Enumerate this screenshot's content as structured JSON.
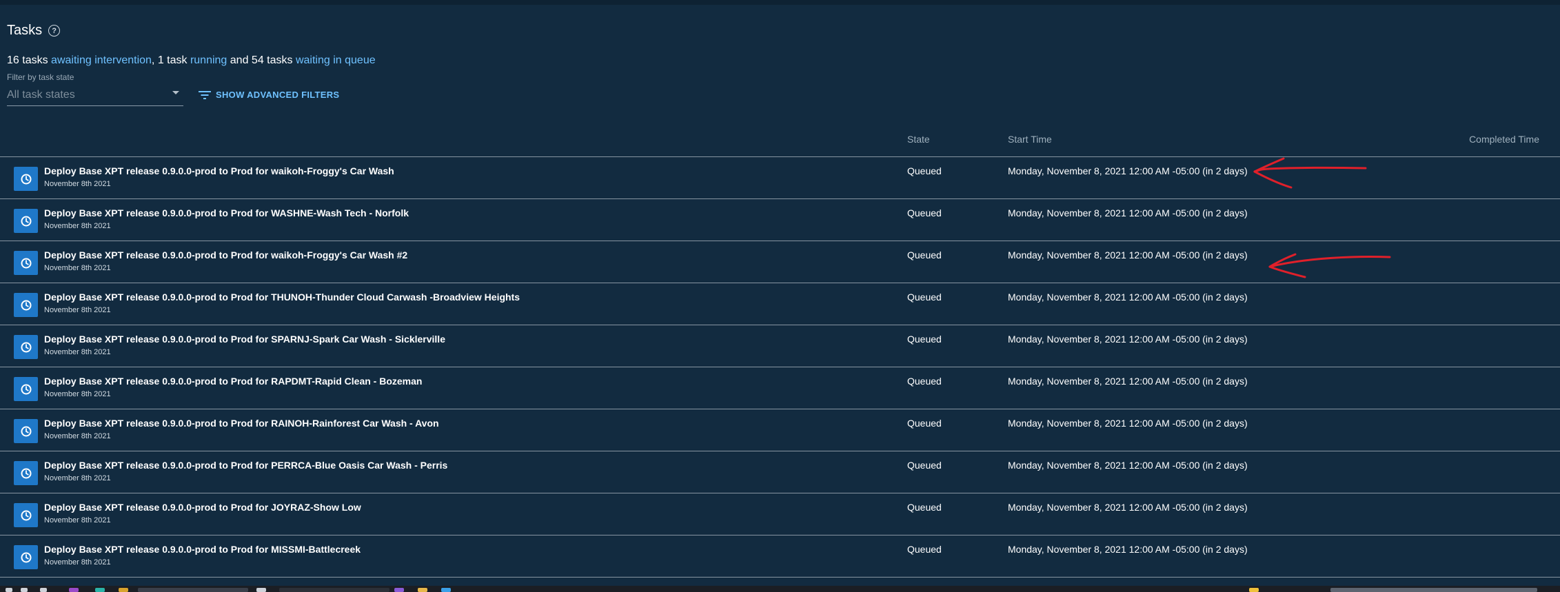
{
  "header": {
    "title": "Tasks"
  },
  "summary": {
    "intervention_count": "16 tasks",
    "intervention_link": "awaiting intervention",
    "sep1": ", 1 task",
    "running_link": "running",
    "sep2": "and 54 tasks",
    "queue_link": "waiting in queue"
  },
  "filter": {
    "label": "Filter by task state",
    "value": "All task states",
    "advanced_label": "SHOW ADVANCED FILTERS"
  },
  "columns": {
    "state": "State",
    "start_time": "Start Time",
    "completed_time": "Completed Time"
  },
  "rows": [
    {
      "title": "Deploy Base XPT release 0.9.0.0-prod to Prod for waikoh-Froggy's Car Wash",
      "date": "November 8th 2021",
      "state": "Queued",
      "start": "Monday, November 8, 2021 12:00 AM -05:00 (in 2 days)"
    },
    {
      "title": "Deploy Base XPT release 0.9.0.0-prod to Prod for WASHNE-Wash Tech - Norfolk",
      "date": "November 8th 2021",
      "state": "Queued",
      "start": "Monday, November 8, 2021 12:00 AM -05:00 (in 2 days)"
    },
    {
      "title": "Deploy Base XPT release 0.9.0.0-prod to Prod for waikoh-Froggy's Car Wash #2",
      "date": "November 8th 2021",
      "state": "Queued",
      "start": "Monday, November 8, 2021 12:00 AM -05:00 (in 2 days)"
    },
    {
      "title": "Deploy Base XPT release 0.9.0.0-prod to Prod for THUNOH-Thunder Cloud Carwash -Broadview Heights",
      "date": "November 8th 2021",
      "state": "Queued",
      "start": "Monday, November 8, 2021 12:00 AM -05:00 (in 2 days)"
    },
    {
      "title": "Deploy Base XPT release 0.9.0.0-prod to Prod for SPARNJ-Spark Car Wash - Sicklerville",
      "date": "November 8th 2021",
      "state": "Queued",
      "start": "Monday, November 8, 2021 12:00 AM -05:00 (in 2 days)"
    },
    {
      "title": "Deploy Base XPT release 0.9.0.0-prod to Prod for RAPDMT-Rapid Clean - Bozeman",
      "date": "November 8th 2021",
      "state": "Queued",
      "start": "Monday, November 8, 2021 12:00 AM -05:00 (in 2 days)"
    },
    {
      "title": "Deploy Base XPT release 0.9.0.0-prod to Prod for RAINOH-Rainforest Car Wash - Avon",
      "date": "November 8th 2021",
      "state": "Queued",
      "start": "Monday, November 8, 2021 12:00 AM -05:00 (in 2 days)"
    },
    {
      "title": "Deploy Base XPT release 0.9.0.0-prod to Prod for PERRCA-Blue Oasis Car Wash - Perris",
      "date": "November 8th 2021",
      "state": "Queued",
      "start": "Monday, November 8, 2021 12:00 AM -05:00 (in 2 days)"
    },
    {
      "title": "Deploy Base XPT release 0.9.0.0-prod to Prod for JOYRAZ-Show Low",
      "date": "November 8th 2021",
      "state": "Queued",
      "start": "Monday, November 8, 2021 12:00 AM -05:00 (in 2 days)"
    },
    {
      "title": "Deploy Base XPT release 0.9.0.0-prod to Prod for MISSMI-Battlecreek",
      "date": "November 8th 2021",
      "state": "Queued",
      "start": "Monday, November 8, 2021 12:00 AM -05:00 (in 2 days)"
    }
  ],
  "icons": {
    "help": "help-circle-icon",
    "filter": "filter-list-icon",
    "dropdown": "dropdown-caret-icon",
    "task": "clock-icon"
  },
  "colors": {
    "background": "#122b40",
    "link": "#6fc1ff",
    "task_icon_bg": "#1f78c8",
    "annotation": "#e0202a"
  }
}
